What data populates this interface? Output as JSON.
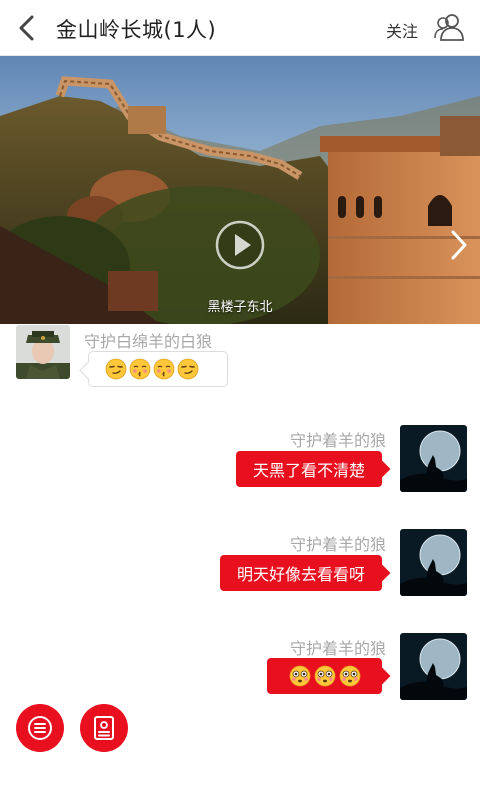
{
  "header": {
    "title": "金山岭长城(1人)",
    "follow_label": "关注"
  },
  "banner": {
    "caption": "黑楼子东北"
  },
  "messages": [
    {
      "sender": "守护白绵羊的白狼",
      "side": "left",
      "type": "emoji",
      "emojis": [
        "smirk",
        "kiss",
        "kiss",
        "smirk"
      ]
    },
    {
      "sender": "守护着羊的狼",
      "side": "right",
      "type": "text",
      "text": "天黑了看不清楚"
    },
    {
      "sender": "守护着羊的狼",
      "side": "right",
      "type": "text",
      "text": "明天好像去看看呀"
    },
    {
      "sender": "守护着羊的狼",
      "side": "right",
      "type": "emoji",
      "emojis": [
        "flushed",
        "flushed",
        "flushed"
      ]
    }
  ],
  "colors": {
    "accent": "#e8101f",
    "name_text": "#a8a8a8"
  },
  "icons": {
    "back": "chevron-left-icon",
    "members": "group-icon",
    "play": "play-icon",
    "next": "chevron-right-icon",
    "menu": "list-icon",
    "profile": "id-card-icon"
  }
}
